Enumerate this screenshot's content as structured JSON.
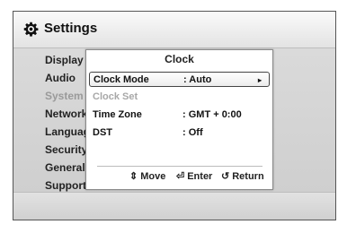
{
  "header": {
    "title": "Settings",
    "icon": "gear-icon"
  },
  "sidebar": {
    "items": [
      {
        "label": "Display"
      },
      {
        "label": "Audio"
      },
      {
        "label": "System"
      },
      {
        "label": "Network"
      },
      {
        "label": "Language"
      },
      {
        "label": "Security"
      },
      {
        "label": "General"
      },
      {
        "label": "Support"
      }
    ]
  },
  "dialog": {
    "title": "Clock",
    "rows": [
      {
        "label": "Clock Mode",
        "value": ": Auto",
        "arrow": "▸"
      },
      {
        "label": "Clock Set"
      },
      {
        "label": "Time Zone",
        "value": ": GMT + 0:00"
      },
      {
        "label": "DST",
        "value": ": Off"
      }
    ],
    "footer": {
      "move_icon": "⇕",
      "move_label": "Move",
      "enter_icon": "⏎",
      "enter_label": "Enter",
      "return_icon": "↺",
      "return_label": "Return"
    }
  }
}
